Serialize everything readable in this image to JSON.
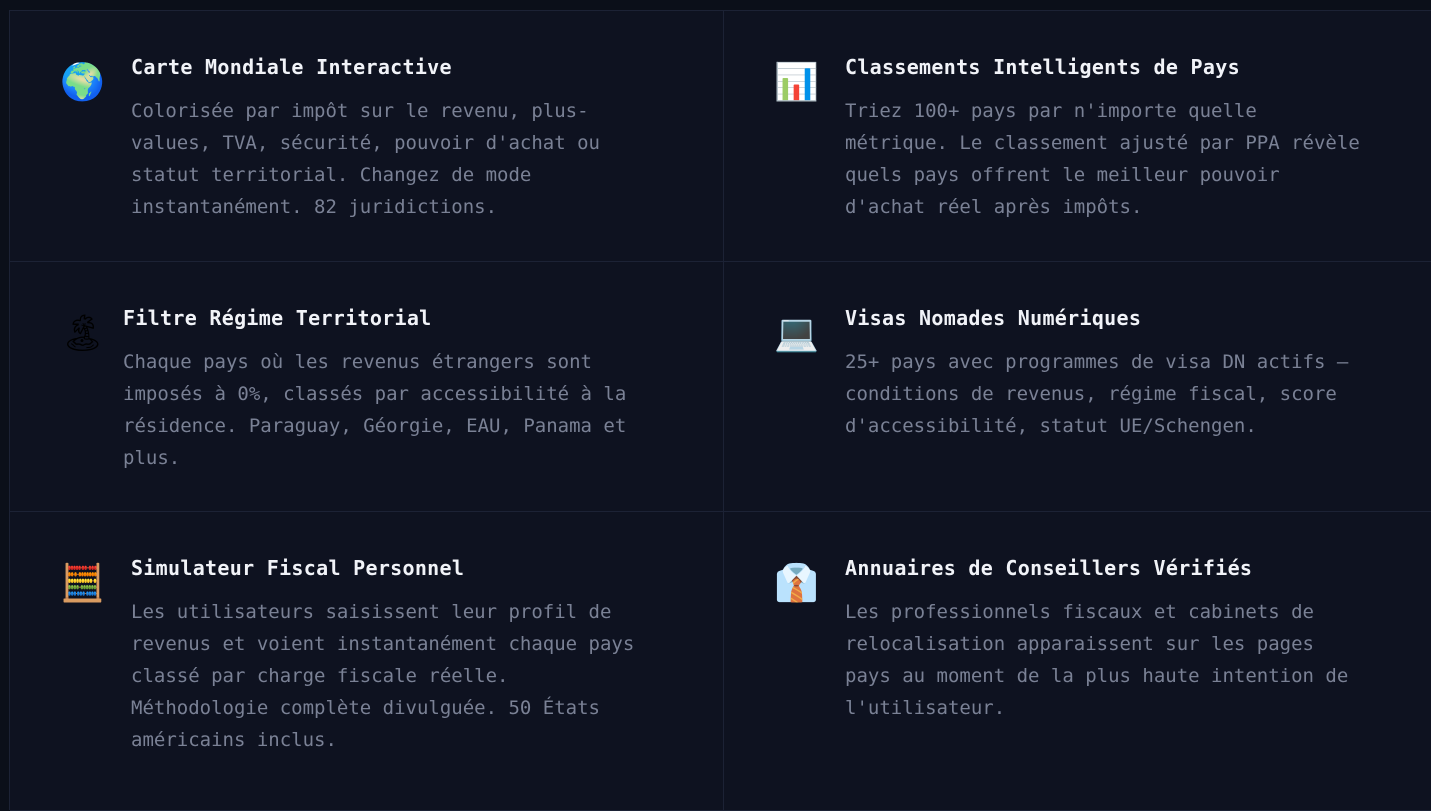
{
  "features": [
    {
      "icon": "🌍",
      "icon_name": "globe-icon",
      "title": "Carte Mondiale Interactive",
      "description_lines": [
        "Colorisée par impôt sur le revenu, plus-",
        "values, TVA, sécurité, pouvoir d'achat ou",
        "statut territorial. Changez de mode",
        "instantanément. 82 juridictions."
      ]
    },
    {
      "icon": "📊",
      "icon_name": "bar-chart-icon",
      "title": "Classements Intelligents de Pays",
      "description_lines": [
        "Triez 100+ pays par n'importe quelle",
        "métrique. Le classement ajusté par PPA révèle",
        "quels pays offrent le meilleur pouvoir",
        "d'achat réel après impôts."
      ]
    },
    {
      "icon": "🏝",
      "icon_name": "island-icon",
      "title": "Filtre Régime Territorial",
      "description_lines": [
        "Chaque pays où les revenus étrangers sont",
        "imposés à 0%, classés par accessibilité à la",
        "résidence. Paraguay, Géorgie, EAU, Panama et",
        "plus."
      ]
    },
    {
      "icon": "💻",
      "icon_name": "laptop-icon",
      "title": "Visas Nomades Numériques",
      "description_lines": [
        "25+ pays avec programmes de visa DN actifs —",
        "conditions de revenus, régime fiscal, score",
        "d'accessibilité, statut UE/Schengen."
      ]
    },
    {
      "icon": "🧮",
      "icon_name": "abacus-icon",
      "title": "Simulateur Fiscal Personnel",
      "description_lines": [
        "Les utilisateurs saisissent leur profil de",
        "revenus et voient instantanément chaque pays",
        "classé par charge fiscale réelle.",
        "Méthodologie complète divulguée. 50 États",
        "américains inclus."
      ]
    },
    {
      "icon": "👔",
      "icon_name": "shirt-tie-icon",
      "title": "Annuaires de Conseillers Vérifiés",
      "description_lines": [
        "Les professionnels fiscaux et cabinets de",
        "relocalisation apparaissent sur les pages",
        "pays au moment de la plus haute intention de",
        "l'utilisateur."
      ]
    }
  ]
}
